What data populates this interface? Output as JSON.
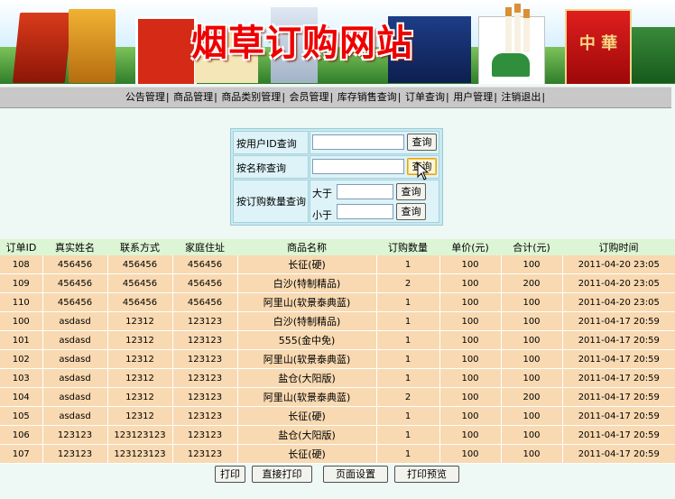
{
  "header": {
    "title": "烟草订购网站"
  },
  "nav": {
    "items": [
      "公告管理",
      "商品管理",
      "商品类别管理",
      "会员管理",
      "库存销售查询",
      "订单查询",
      "用户管理",
      "注销退出"
    ],
    "separator": "|"
  },
  "query": {
    "by_user_label": "按用户ID查询",
    "by_name_label": "按名称查询",
    "by_qty_label": "按订购数量查询",
    "greater_label": "大于",
    "less_label": "小于",
    "button_label": "查询",
    "user_value": "",
    "name_value": "",
    "greater_value": "",
    "less_value": ""
  },
  "table": {
    "columns": [
      "订单ID",
      "真实姓名",
      "联系方式",
      "家庭住址",
      "商品名称",
      "订购数量",
      "单价(元)",
      "合计(元)",
      "订购时间"
    ],
    "rows": [
      [
        "108",
        "456456",
        "456456",
        "456456",
        "长征(硬)",
        "1",
        "100",
        "100",
        "2011-04-20 23:05"
      ],
      [
        "109",
        "456456",
        "456456",
        "456456",
        "白沙(特制精品)",
        "2",
        "100",
        "200",
        "2011-04-20 23:05"
      ],
      [
        "110",
        "456456",
        "456456",
        "456456",
        "阿里山(软景泰典蓝)",
        "1",
        "100",
        "100",
        "2011-04-20 23:05"
      ],
      [
        "100",
        "asdasd",
        "12312",
        "123123",
        "白沙(特制精品)",
        "1",
        "100",
        "100",
        "2011-04-17 20:59"
      ],
      [
        "101",
        "asdasd",
        "12312",
        "123123",
        "555(金中免)",
        "1",
        "100",
        "100",
        "2011-04-17 20:59"
      ],
      [
        "102",
        "asdasd",
        "12312",
        "123123",
        "阿里山(软景泰典蓝)",
        "1",
        "100",
        "100",
        "2011-04-17 20:59"
      ],
      [
        "103",
        "asdasd",
        "12312",
        "123123",
        "盐仓(大阳版)",
        "1",
        "100",
        "100",
        "2011-04-17 20:59"
      ],
      [
        "104",
        "asdasd",
        "12312",
        "123123",
        "阿里山(软景泰典蓝)",
        "2",
        "100",
        "200",
        "2011-04-17 20:59"
      ],
      [
        "105",
        "asdasd",
        "12312",
        "123123",
        "长征(硬)",
        "1",
        "100",
        "100",
        "2011-04-17 20:59"
      ],
      [
        "106",
        "123123",
        "123123123",
        "123123",
        "盐仓(大阳版)",
        "1",
        "100",
        "100",
        "2011-04-17 20:59"
      ],
      [
        "107",
        "123123",
        "123123123",
        "123123",
        "长征(硬)",
        "1",
        "100",
        "100",
        "2011-04-17 20:59"
      ]
    ]
  },
  "footer": {
    "buttons": [
      "打印",
      "直接打印",
      "页面设置",
      "打印预览"
    ]
  },
  "colors": {
    "title_red": "#ee0000",
    "table_header_bg": "#dcf5d4",
    "table_row_bg": "#f8d9b1",
    "query_bg": "#c7eaf2"
  },
  "icons": {
    "cursor": "arrow-pointer-icon"
  }
}
